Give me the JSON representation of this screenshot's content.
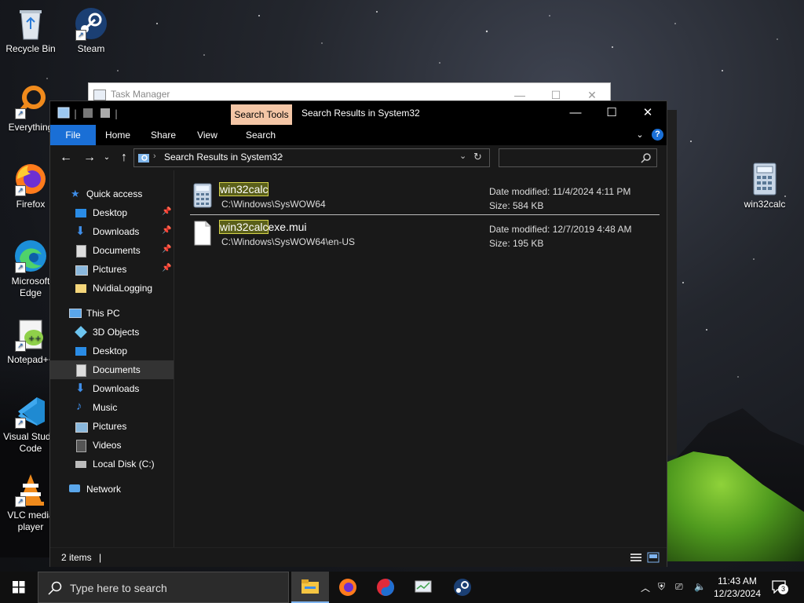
{
  "desktop": {
    "icons": [
      {
        "label": "Recycle Bin"
      },
      {
        "label": "Steam"
      },
      {
        "label": "Everything"
      },
      {
        "label": "Firefox"
      },
      {
        "label": "Microsoft Edge"
      },
      {
        "label": "Notepad++"
      },
      {
        "label": "Visual Studio Code"
      },
      {
        "label": "VLC media player"
      },
      {
        "label": "win32calc"
      }
    ]
  },
  "task_manager": {
    "title": "Task Manager"
  },
  "explorer": {
    "title": "Search Results in System32",
    "context_tab": "Search Tools",
    "ribbon_tabs": [
      "File",
      "Home",
      "Share",
      "View",
      "Search"
    ],
    "address": "Search Results in System32",
    "search_placeholder": "",
    "sidebar": [
      {
        "label": "Quick access"
      },
      {
        "label": "Desktop"
      },
      {
        "label": "Downloads"
      },
      {
        "label": "Documents"
      },
      {
        "label": "Pictures"
      },
      {
        "label": "NvidiaLogging"
      },
      {
        "label": "This PC"
      },
      {
        "label": "3D Objects"
      },
      {
        "label": "Desktop"
      },
      {
        "label": "Documents"
      },
      {
        "label": "Downloads"
      },
      {
        "label": "Music"
      },
      {
        "label": "Pictures"
      },
      {
        "label": "Videos"
      },
      {
        "label": "Local Disk (C:)"
      },
      {
        "label": "Network"
      }
    ],
    "results": [
      {
        "match": "win32calc",
        "rest": "",
        "path": "C:\\Windows\\SysWOW64",
        "modified": "Date modified: 11/4/2024 4:11 PM",
        "size": "Size: 584 KB"
      },
      {
        "match": "win32calc",
        "rest": "exe.mui",
        "path": "C:\\Windows\\SysWOW64\\en-US",
        "modified": "Date modified: 12/7/2019 4:48 AM",
        "size": "Size: 195 KB"
      }
    ],
    "status": "2 items"
  },
  "taskbar": {
    "search_placeholder": "Type here to search",
    "time": "11:43 AM",
    "date": "12/23/2024",
    "notifications": "3"
  }
}
